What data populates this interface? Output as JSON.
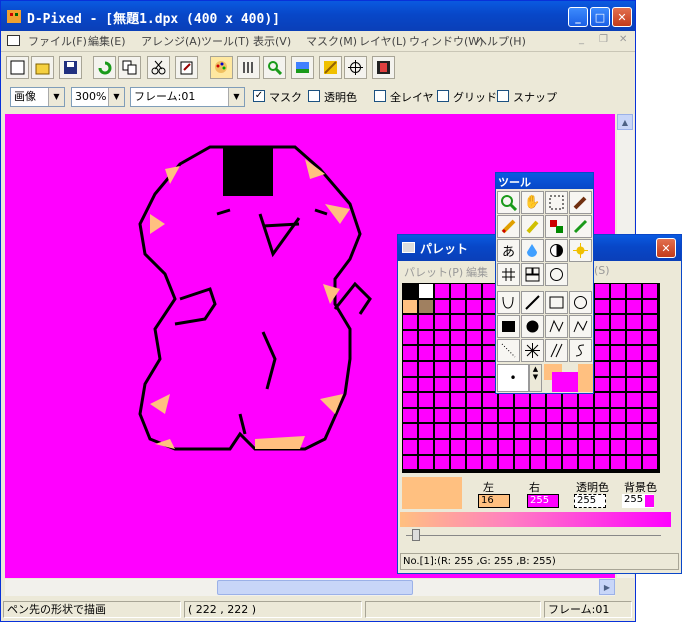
{
  "window": {
    "title": "D-Pixed - [無題1.dpx (400 x 400)]",
    "min_label": "_",
    "max_label": "□",
    "close_label": "✕"
  },
  "menu": {
    "items": [
      "ファイル(F)",
      "編集(E)",
      "アレンジ(A)",
      "ツール(T)",
      "表示(V)",
      "マスク(M)",
      "レイヤ(L)",
      "ウィンドウ(W)",
      "ヘルプ(H)"
    ]
  },
  "toolbar": {
    "view_mode": "画像",
    "zoom": "300%",
    "frame": "フレーム:01",
    "mask_label": "マスク",
    "transparent_label": "透明色",
    "all_layer_label": "全レイヤ",
    "grid_label": "グリッド",
    "snap_label": "スナップ",
    "mask_checked": true
  },
  "status": {
    "hint": "ペン先の形状で描画",
    "coords": "( 222 , 222 )",
    "frame": "フレーム:01"
  },
  "palette": {
    "title": "パレット",
    "menu_palette": "パレット(P)",
    "menu_edit": "編集",
    "menu_s": "(S)",
    "left_label": "左",
    "right_label": "右",
    "transparent_label": "透明色",
    "bg_label": "背景色",
    "left_value": "16",
    "right_value": "255",
    "transparent_value": "255",
    "bg_value": "255",
    "info": "No.[1]:(R: 255 ,G: 255 ,B: 255)",
    "colors": {
      "magenta": "#ff00ff",
      "skin": "#ffc080",
      "black": "#000000",
      "white": "#ffffff",
      "brown": "#a08060"
    }
  },
  "tools": {
    "title": "ツール",
    "text_tool_glyph": "あ"
  },
  "colors": {
    "canvas_bg": "#ff00ff",
    "title_blue": "#0a47c8",
    "chrome": "#ece9d8"
  }
}
